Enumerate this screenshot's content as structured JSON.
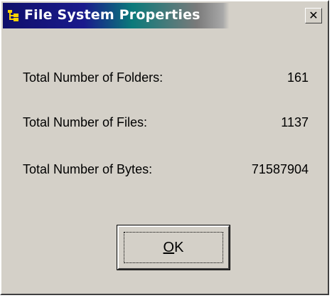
{
  "window": {
    "title": "File System Properties",
    "title_icon": "folder-tree-icon",
    "close_glyph": "✕"
  },
  "stats": [
    {
      "label": "Total Number of Folders:",
      "value": "161"
    },
    {
      "label": "Total Number of Files:",
      "value": "1137"
    },
    {
      "label": "Total Number of Bytes:",
      "value": "71587904"
    }
  ],
  "buttons": {
    "ok_mnemonic": "O",
    "ok_rest": "K"
  },
  "colors": {
    "face": "#d4d0c8",
    "title_active": "#10106b"
  }
}
